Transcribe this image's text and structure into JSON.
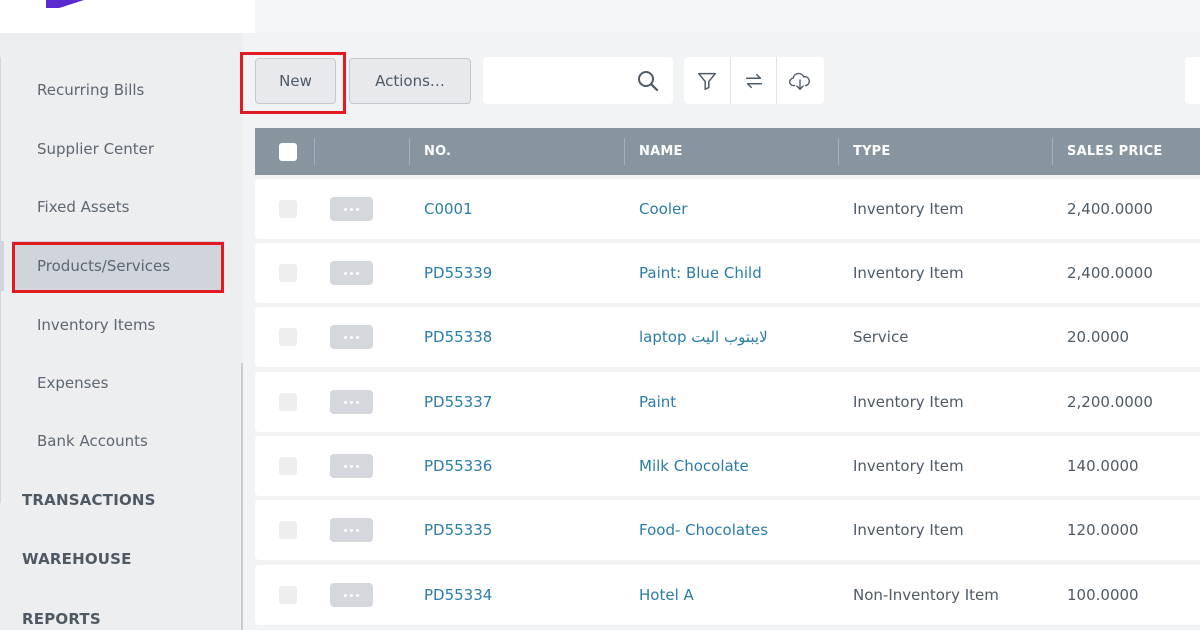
{
  "sidebar": {
    "items": [
      {
        "label": "Recurring Bills"
      },
      {
        "label": "Supplier Center"
      },
      {
        "label": "Fixed Assets"
      },
      {
        "label": "Products/Services"
      },
      {
        "label": "Inventory Items"
      },
      {
        "label": "Expenses"
      },
      {
        "label": "Bank Accounts"
      }
    ],
    "active_item": "Products/Services",
    "sections": [
      {
        "label": "TRANSACTIONS"
      },
      {
        "label": "WAREHOUSE"
      },
      {
        "label": "REPORTS"
      }
    ]
  },
  "toolbar": {
    "new_label": "New",
    "actions_label": "Actions…",
    "search": {
      "value": "",
      "placeholder": ""
    },
    "icons": [
      "filter-icon",
      "swap-arrows-icon",
      "cloud-download-icon"
    ]
  },
  "table": {
    "columns": [
      "NO.",
      "NAME",
      "TYPE",
      "SALES PRICE"
    ],
    "rows": [
      {
        "no": "C0001",
        "name": "Cooler",
        "type": "Inventory Item",
        "price": "2,400.0000"
      },
      {
        "no": "PD55339",
        "name": "Paint: Blue Child",
        "type": "Inventory Item",
        "price": "2,400.0000"
      },
      {
        "no": "PD55338",
        "name": "laptop لايبتوب اليت",
        "type": "Service",
        "price": "20.0000"
      },
      {
        "no": "PD55337",
        "name": "Paint",
        "type": "Inventory Item",
        "price": "2,200.0000"
      },
      {
        "no": "PD55336",
        "name": "Milk Chocolate",
        "type": "Inventory Item",
        "price": "140.0000"
      },
      {
        "no": "PD55335",
        "name": "Food- Chocolates",
        "type": "Inventory Item",
        "price": "120.0000"
      },
      {
        "no": "PD55334",
        "name": "Hotel A",
        "type": "Non-Inventory Item",
        "price": "100.0000"
      }
    ]
  },
  "colors": {
    "accent_link": "#2a7da8",
    "header_bg": "#8795a1",
    "highlight": "#e21b22",
    "brand": "#5a2ad0"
  }
}
